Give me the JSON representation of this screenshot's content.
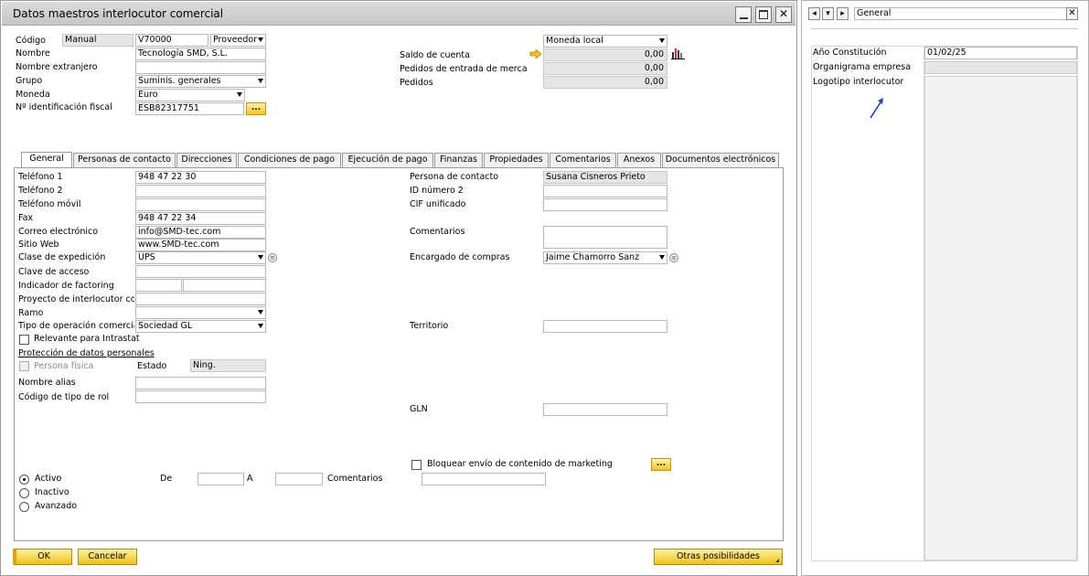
{
  "window": {
    "title": "Datos maestros interlocutor comercial"
  },
  "header": {
    "codigo_label": "Código",
    "codigo_series": "Manual",
    "codigo_value": "V70000",
    "codigo_type": "Proveedor",
    "nombre_label": "Nombre",
    "nombre_value": "Tecnología SMD, S.L.",
    "nombre_ext_label": "Nombre extranjero",
    "nombre_ext_value": "",
    "grupo_label": "Grupo",
    "grupo_value": "Suminis. generales",
    "moneda_label": "Moneda",
    "moneda_value": "Euro",
    "nif_label": "Nº identificación fiscal",
    "nif_value": "ESB82317751",
    "currency_select": "Moneda local",
    "saldo_label": "Saldo de cuenta",
    "saldo_value": "0,00",
    "pedidos_entrada_label": "Pedidos de entrada de mercanc",
    "pedidos_entrada_value": "0,00",
    "pedidos_label": "Pedidos",
    "pedidos_value": "0,00",
    "ellipsis": "..."
  },
  "tabs": [
    "General",
    "Personas de contacto",
    "Direcciones",
    "Condiciones de pago",
    "Ejecución de pago",
    "Finanzas",
    "Propiedades",
    "Comentarios",
    "Anexos",
    "Documentos electrónicos"
  ],
  "general": {
    "telefono1_label": "Teléfono 1",
    "telefono1_value": "948 47 22 30",
    "telefono2_label": "Teléfono 2",
    "telefono2_value": "",
    "movil_label": "Teléfono móvil",
    "movil_value": "",
    "fax_label": "Fax",
    "fax_value": "948 47 22 34",
    "correo_label": "Correo electrónico",
    "correo_value": "info@SMD-tec.com",
    "web_label": "Sitio Web",
    "web_value": "www.SMD-tec.com",
    "expedicion_label": "Clase de expedición",
    "expedicion_value": "UPS",
    "clave_label": "Clave de acceso",
    "clave_value": "",
    "factoring_label": "Indicador de factoring",
    "proyecto_label": "Proyecto de interlocutor cor",
    "proyecto_value": "",
    "ramo_label": "Ramo",
    "ramo_value": "",
    "tipo_op_label": "Tipo de operación comercial",
    "tipo_op_value": "Sociedad GL",
    "intrastat_label": "Relevante para Intrastat",
    "proteccion_label": "Protección de datos personales",
    "persona_fisica_label": "Persona física",
    "estado_label": "Estado",
    "estado_value": "Ning.",
    "alias_label": "Nombre alias",
    "alias_value": "",
    "rol_label": "Código de tipo de rol",
    "rol_value": "",
    "contacto_label": "Persona de contacto",
    "contacto_value": "Susana Cisneros Prieto",
    "id2_label": "ID número 2",
    "id2_value": "",
    "cif_label": "CIF unificado",
    "cif_value": "",
    "comentarios_label": "Comentarios",
    "comentarios_value": "",
    "encargado_label": "Encargado de compras",
    "encargado_value": "Jaime Chamorro Sanz",
    "territorio_label": "Territorio",
    "territorio_value": "",
    "gln_label": "GLN",
    "gln_value": "",
    "marketing_label": "Bloquear envío de contenido de marketing",
    "activo_label": "Activo",
    "inactivo_label": "Inactivo",
    "avanzado_label": "Avanzado",
    "de_label": "De",
    "a_label": "A",
    "status_comentarios_label": "Comentarios"
  },
  "footer": {
    "ok": "OK",
    "cancel": "Cancelar",
    "more": "Otras posibilidades"
  },
  "side": {
    "select_value": "General",
    "ano_label": "Año Constitución",
    "ano_value": "01/02/25",
    "organigrama_label": "Organigrama empresa",
    "logotipo_label": "Logotipo interlocutor"
  },
  "colors": {
    "accent": "#f5c518",
    "arrow": "#1a3fcf"
  }
}
